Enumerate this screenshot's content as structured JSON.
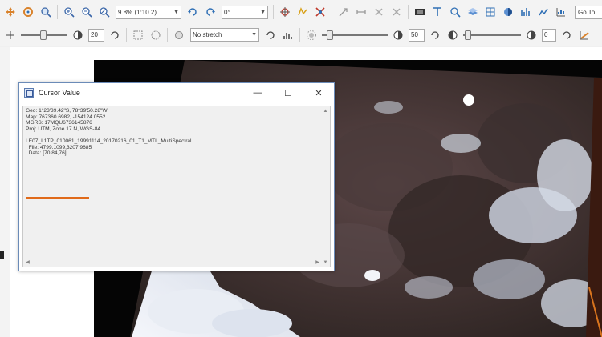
{
  "toolbar1": {
    "zoom_combo": "9.8% (1:10.2)",
    "rotation_combo": "0°",
    "goto_text": "Go To"
  },
  "toolbar2": {
    "sharpen_value": "20",
    "stretch_combo": "No stretch",
    "brightness_value": "50",
    "transparency_value": "0"
  },
  "dialog": {
    "title": "Cursor Value",
    "minimize_glyph": "—",
    "maximize_glyph": "☐",
    "close_glyph": "✕",
    "lines": [
      "Geo: 1°23'39.42\"S, 78°39'50.28\"W",
      "Map: 767360.6982, -154124.0552",
      "MGRS: 17MQU6736145876",
      "Proj: UTM, Zone 17 N, WGS-84",
      "",
      "LE07_L1TP_010061_19991114_20170216_01_T1_MTL_MultiSpectral",
      "  File: 4799.1099,3207.9685",
      "  Data: [70,84,76]"
    ],
    "underline_color": "#e06a1a"
  },
  "colors": {
    "accent_underline": "#e06a1a",
    "window_border": "#6b8bb8"
  }
}
